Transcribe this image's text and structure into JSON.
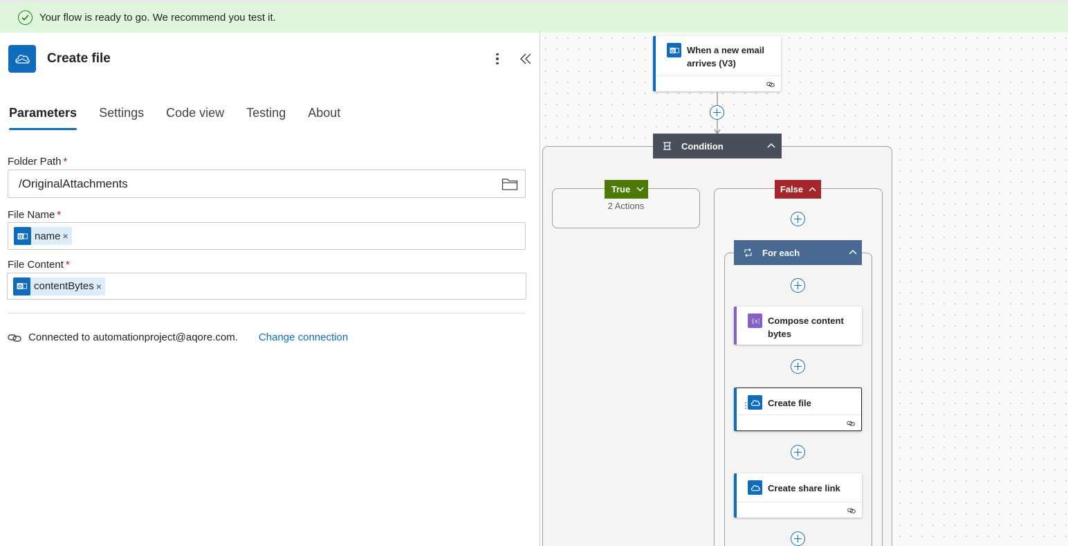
{
  "banner": {
    "message": "Your flow is ready to go. We recommend you test it."
  },
  "panel": {
    "title": "Create file",
    "tabs": [
      "Parameters",
      "Settings",
      "Code view",
      "Testing",
      "About"
    ],
    "active_tab": "Parameters",
    "fields": {
      "folder_path": {
        "label": "Folder Path",
        "required": "*",
        "value": "/OriginalAttachments"
      },
      "file_name": {
        "label": "File Name",
        "required": "*",
        "token": "name"
      },
      "file_content": {
        "label": "File Content",
        "required": "*",
        "token": "contentBytes"
      }
    },
    "connection": {
      "text": "Connected to automationproject@aqore.com.",
      "change_label": "Change connection"
    }
  },
  "canvas": {
    "trigger": {
      "title_line1": "When a new email",
      "title_line2": "arrives (V3)"
    },
    "condition": {
      "title": "Condition"
    },
    "true_branch": {
      "label": "True",
      "summary": "2 Actions"
    },
    "false_branch": {
      "label": "False"
    },
    "for_each": {
      "title": "For each"
    },
    "compose": {
      "title_line1": "Compose content",
      "title_line2": "bytes"
    },
    "create_file": {
      "title": "Create file"
    },
    "create_share_link": {
      "title": "Create share link"
    }
  },
  "colors": {
    "accent": "#0f6cbd",
    "banner_bg": "#dff6dd",
    "success": "#107c10",
    "condition": "#484f5a",
    "true": "#4b7a05",
    "false": "#a4262c",
    "for_each": "#486991",
    "compose": "#8661c5"
  },
  "icons": [
    "check-circle-icon",
    "onedrive-cloud-icon",
    "more-vertical-icon",
    "double-chevron-left-icon",
    "folder-icon",
    "outlook-icon",
    "link-icon",
    "condition-icon",
    "chevron-up-icon",
    "chevron-down-icon",
    "loop-icon",
    "compose-icon",
    "add-step-icon"
  ]
}
